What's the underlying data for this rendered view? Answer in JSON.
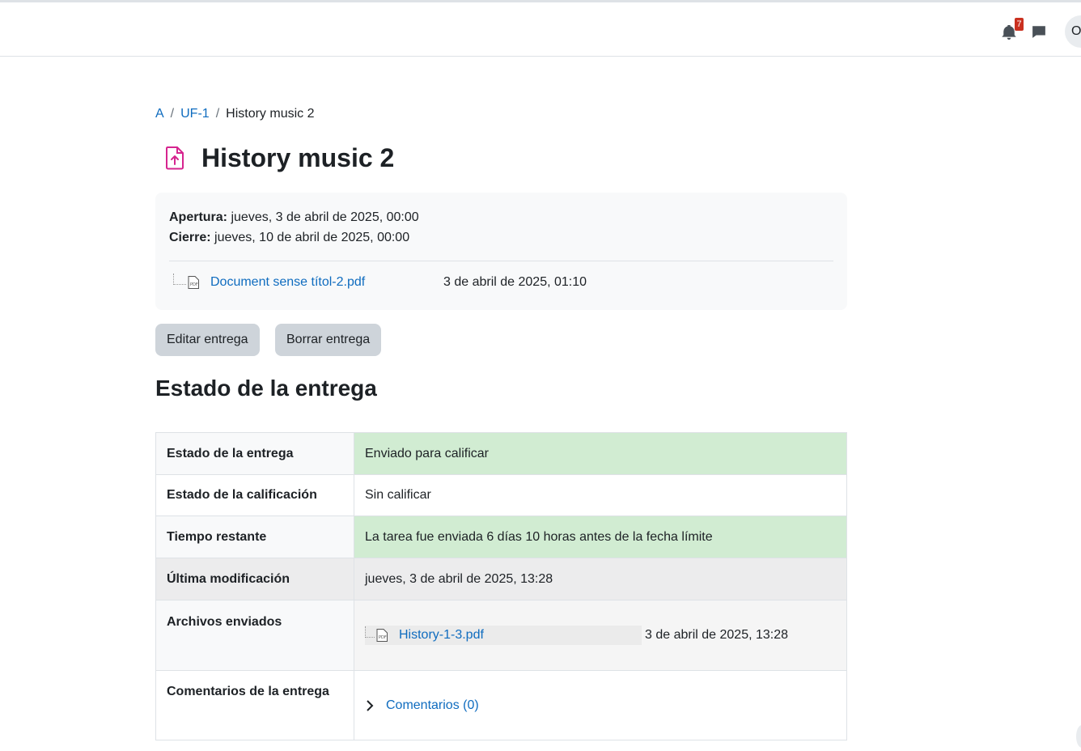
{
  "header": {
    "notification_count": "7",
    "user_initial": "O",
    "icons": [
      "bell-icon",
      "chat-icon"
    ]
  },
  "breadcrumb": {
    "items": [
      "A",
      "UF-1"
    ],
    "current": "History music 2",
    "separator": "/"
  },
  "page": {
    "title": "History music 2",
    "icon": "assignment-upload-icon",
    "icon_color": "#d6248f"
  },
  "dates": {
    "open_label": "Apertura:",
    "open_value": "jueves, 3 de abril de 2025, 00:00",
    "close_label": "Cierre:",
    "close_value": "jueves, 10 de abril de 2025, 00:00",
    "attachment_name": "Document sense títol-2.pdf",
    "attachment_date": "3 de abril de 2025, 01:10"
  },
  "actions": {
    "edit_label": "Editar entrega",
    "delete_label": "Borrar entrega"
  },
  "status_section": {
    "title": "Estado de la entrega",
    "rows": {
      "submission_status": {
        "label": "Estado de la entrega",
        "value": "Enviado para calificar"
      },
      "grading_status": {
        "label": "Estado de la calificación",
        "value": "Sin calificar"
      },
      "time_remaining": {
        "label": "Tiempo restante",
        "value": "La tarea fue enviada 6 días 10 horas antes de la fecha límite"
      },
      "last_modified": {
        "label": "Última modificación",
        "value": "jueves, 3 de abril de 2025, 13:28"
      },
      "files": {
        "label": "Archivos enviados",
        "file_name": "History-1-3.pdf",
        "file_date": "3 de abril de 2025, 13:28"
      },
      "comments": {
        "label": "Comentarios de la entrega",
        "link": "Comentarios (0)"
      }
    }
  },
  "colors": {
    "link": "#0f6cbf",
    "success_bg": "#d1ecd2",
    "button_bg": "#ced4da"
  }
}
